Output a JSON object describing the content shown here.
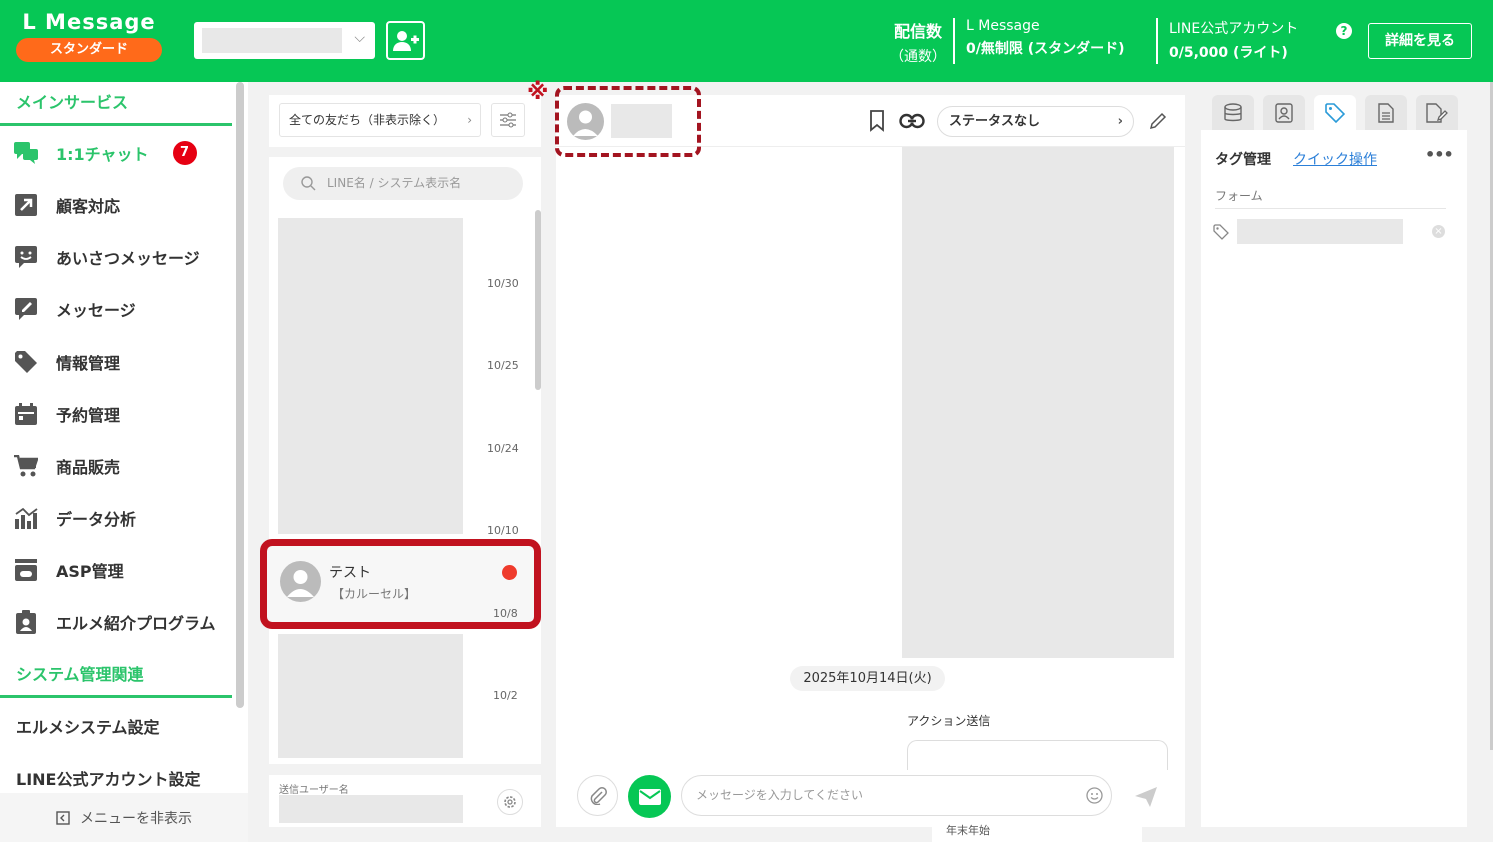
{
  "header": {
    "brand_name": "L Message",
    "brand_plan": "スタンダード",
    "stat_label_1": "配信数",
    "stat_label_2": "（通数）",
    "lm_title": "L Message",
    "lm_value": "0/無制限 (スタンダード)",
    "line_title": "LINE公式アカウント",
    "line_value": "0/5,000 (ライト)",
    "help_glyph": "?",
    "detail_button": "詳細を見る",
    "colors": {
      "brand_green": "#06c755",
      "plan_orange": "#ff6a1a"
    }
  },
  "sidebar": {
    "section_main": "メインサービス",
    "items": [
      {
        "label": "1:1チャット",
        "icon": "chat-bubbles-icon",
        "badge": "7"
      },
      {
        "label": "顧客対応",
        "icon": "arrow-box-icon"
      },
      {
        "label": "あいさつメッセージ",
        "icon": "smile-bubble-icon"
      },
      {
        "label": "メッセージ",
        "icon": "pencil-bubble-icon"
      },
      {
        "label": "情報管理",
        "icon": "tag-icon"
      },
      {
        "label": "予約管理",
        "icon": "calendar-icon"
      },
      {
        "label": "商品販売",
        "icon": "cart-icon"
      },
      {
        "label": "データ分析",
        "icon": "chart-icon"
      },
      {
        "label": "ASP管理",
        "icon": "register-icon"
      },
      {
        "label": "エルメ紹介プログラム",
        "icon": "clipboard-user-icon"
      }
    ],
    "section_system": "システム管理関連",
    "system_items": [
      "エルメシステム設定",
      "LINE公式アカウント設定"
    ],
    "hide_menu": "メニューを非表示"
  },
  "friend_list": {
    "filter_label": "全ての友だち（非表示除く）",
    "search_placeholder": "LINE名 / システム表示名",
    "dates": [
      "10/30",
      "10/25",
      "10/24",
      "10/10",
      "10/8",
      "10/2"
    ],
    "highlighted": {
      "name": "テスト",
      "preview": "【カルーセル】"
    },
    "sender_label": "送信ユーザー名"
  },
  "chat": {
    "annotation_mark": "※",
    "status_label": "ステータスなし",
    "date_separator": "2025年10月14日(火)",
    "action_label": "アクション送信",
    "bottom_peek": "年末年始",
    "input_placeholder": "メッセージを入力してください"
  },
  "right_panel": {
    "tab_icons": [
      "database-icon",
      "contact-icon",
      "tag-icon",
      "document-icon",
      "document-edit-icon"
    ],
    "title": "タグ管理",
    "quick_link": "クイック操作",
    "more": "•••",
    "form_label": "フォーム",
    "remove_glyph": "×",
    "colors": {
      "link_blue": "#2b7fd8",
      "highlight_red": "#c1121f"
    }
  }
}
